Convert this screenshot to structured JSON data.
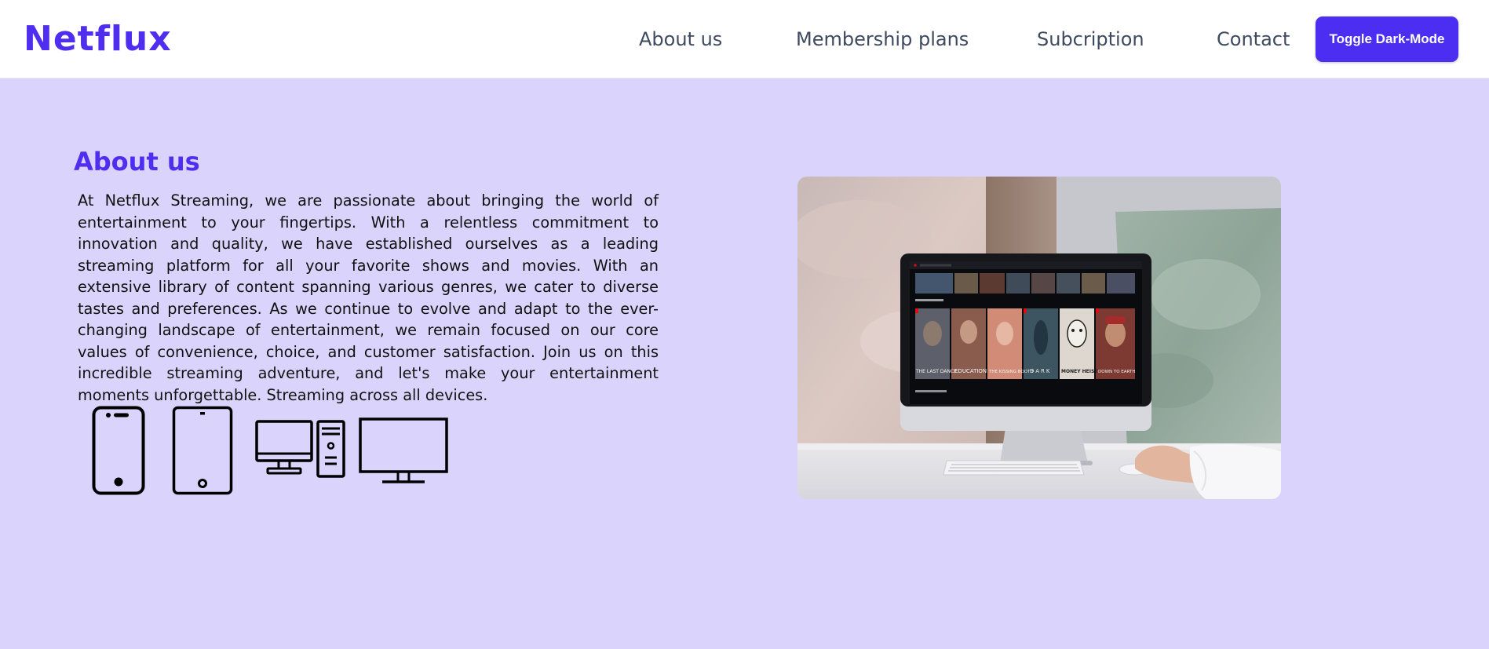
{
  "header": {
    "logo": "Netflux",
    "nav": [
      "About us",
      "Membership plans",
      "Subcription",
      "Contact"
    ],
    "toggle_label": "Toggle Dark-Mode"
  },
  "about": {
    "title": "About us",
    "text": "At Netflux Streaming, we are passionate about bringing the world of entertainment to your fingertips. With a relentless commitment to innovation and quality, we have established ourselves as a leading streaming platform for all your favorite shows and movies. With an extensive library of content spanning various genres, we cater to diverse tastes and preferences. As we continue to evolve and adapt to the ever-changing landscape of entertainment, we remain focused on our core values of convenience, choice, and customer satisfaction. Join us on this incredible streaming adventure, and let's make your entertainment moments unforgettable. Streaming across all devices.",
    "device_icons": [
      "smartphone-icon",
      "tablet-icon",
      "desktop-computer-icon",
      "television-icon"
    ]
  },
  "screen_posters": [
    "THE LAST DANCE",
    "EDUCATION",
    "THE KISSING BOOTH",
    "DARK",
    "MONEY HEIST",
    "DOWN TO EARTH"
  ],
  "colors": {
    "brand": "#4f2ef0",
    "button": "#4b2ef2",
    "section_bg": "#dad4fc",
    "nav_text": "#3e4a5f"
  }
}
